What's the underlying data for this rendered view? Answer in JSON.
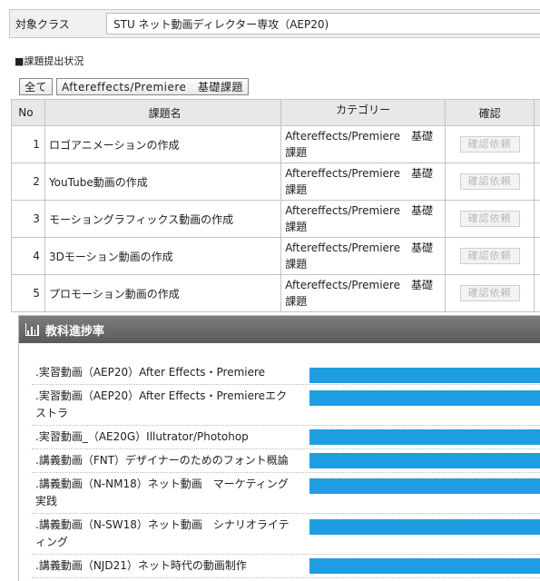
{
  "course": {
    "label": "対象クラス",
    "value": "STU ネット動画ディレクター専攻（AEP20)"
  },
  "section_title": "■課題提出状況",
  "filters": [
    "全て",
    "Aftereffects/Premiere　基礎課題"
  ],
  "table": {
    "headers": [
      "No",
      "課題名",
      "カテゴリー",
      "確認"
    ],
    "rows": [
      {
        "no": "1",
        "name": "ロゴアニメーションの作成",
        "category": "Aftereffects/Premiere　基礎課題",
        "action": "確認依頼"
      },
      {
        "no": "2",
        "name": "YouTube動画の作成",
        "category": "Aftereffects/Premiere　基礎課題",
        "action": "確認依頼"
      },
      {
        "no": "3",
        "name": "モーショングラフィックス動画の作成",
        "category": "Aftereffects/Premiere　基礎課題",
        "action": "確認依頼"
      },
      {
        "no": "4",
        "name": "3Dモーション動画の作成",
        "category": "Aftereffects/Premiere　基礎課題",
        "action": "確認依頼"
      },
      {
        "no": "5",
        "name": "プロモーション動画の作成",
        "category": "Aftereffects/Premiere　基礎課題",
        "action": "確認依頼"
      }
    ]
  },
  "progress_panel": {
    "title": "教科進捗率",
    "icon": "bar-chart-icon",
    "bar_color": "#1e9ee0",
    "items": [
      {
        "label": ".実習動画（AEP20）After Effects・Premiere"
      },
      {
        "label": ".実習動画（AEP20）After Effects・Premiereエクストラ"
      },
      {
        "label": ".実習動画_（AE20G）Illutrator/Photohop"
      },
      {
        "label": ".講義動画（FNT）デザイナーのためのフォント概論"
      },
      {
        "label": ".講義動画（N-NM18）ネット動画　マーケティング実践"
      },
      {
        "label": ".講義動画（N-SW18）ネット動画　シナリオライティング"
      },
      {
        "label": ".講義動画（NJD21）ネット時代の動画制作"
      }
    ]
  }
}
